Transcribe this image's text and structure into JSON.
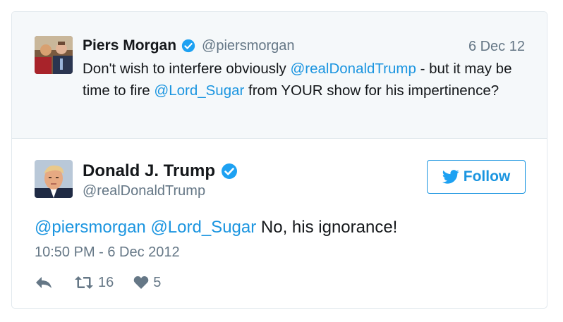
{
  "parent_tweet": {
    "author": {
      "name": "Piers Morgan",
      "handle": "@piersmorgan",
      "verified": true
    },
    "date": "6 Dec 12",
    "text_parts": [
      {
        "text": "Don't wish to interfere obviously ",
        "mention": false
      },
      {
        "text": "@realDonaldTrump",
        "mention": true
      },
      {
        "text": " - but it may be time to fire ",
        "mention": false
      },
      {
        "text": "@Lord_Sugar",
        "mention": true
      },
      {
        "text": " from YOUR show for his impertinence?",
        "mention": false
      }
    ]
  },
  "main_tweet": {
    "author": {
      "name": "Donald J. Trump",
      "handle": "@realDonaldTrump",
      "verified": true
    },
    "follow_label": "Follow",
    "text_parts": [
      {
        "text": "@piersmorgan",
        "mention": true
      },
      {
        "text": " ",
        "mention": false
      },
      {
        "text": "@Lord_Sugar",
        "mention": true
      },
      {
        "text": " No, his ignorance!",
        "mention": false
      }
    ],
    "timestamp": "10:50 PM - 6 Dec 2012",
    "retweet_count": "16",
    "like_count": "5"
  },
  "colors": {
    "link": "#1b95e0",
    "secondary_text": "#657786",
    "parent_background": "#f5f8fa",
    "border": "#e1e8ed"
  },
  "icons": {
    "verified": "verified-badge-icon",
    "reply": "reply-icon",
    "retweet": "retweet-icon",
    "like": "heart-icon",
    "follow": "twitter-bird-icon"
  }
}
